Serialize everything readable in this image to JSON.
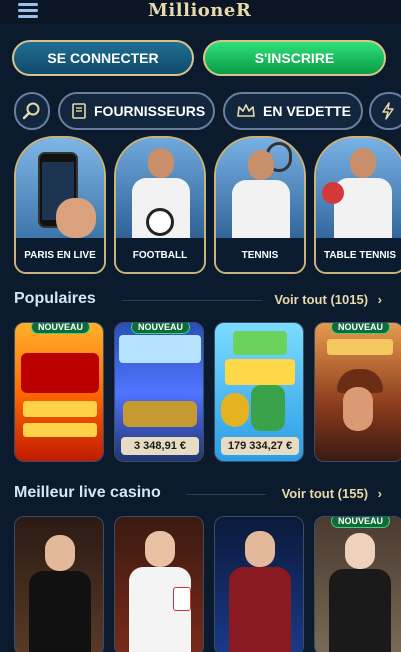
{
  "header": {
    "logo": "MillioneR",
    "menu_icon": "hamburger-menu-icon"
  },
  "auth": {
    "login_label": "SE CONNECTER",
    "signup_label": "S'INSCRIRE"
  },
  "categories": {
    "search_icon": "search-icon",
    "providers_label": "FOURNISSEURS",
    "featured_label": "EN VEDETTE",
    "more_icon": "lightning-icon"
  },
  "quick_links": [
    {
      "label": "PARIS EN LIVE"
    },
    {
      "label": "FOOTBALL"
    },
    {
      "label": "TENNIS"
    },
    {
      "label": "TABLE TENNIS"
    }
  ],
  "popular": {
    "title": "Populaires",
    "link": "Voir tout (1015)",
    "games": [
      {
        "badge": "NOUVEAU",
        "price": ""
      },
      {
        "badge": "NOUVEAU",
        "price": "3 348,91 €"
      },
      {
        "badge": "",
        "price": "179 334,27 €"
      },
      {
        "badge": "NOUVEAU",
        "price": ""
      }
    ]
  },
  "live_casino": {
    "title": "Meilleur live casino",
    "link": "Voir tout (155)",
    "games": [
      {
        "badge": ""
      },
      {
        "badge": ""
      },
      {
        "badge": ""
      },
      {
        "badge": "NOUVEAU"
      }
    ]
  },
  "colors": {
    "background": "#0b1a2c",
    "gold": "#e8d9a8",
    "signup_green": "#1fc466",
    "login_blue": "#15577a"
  }
}
